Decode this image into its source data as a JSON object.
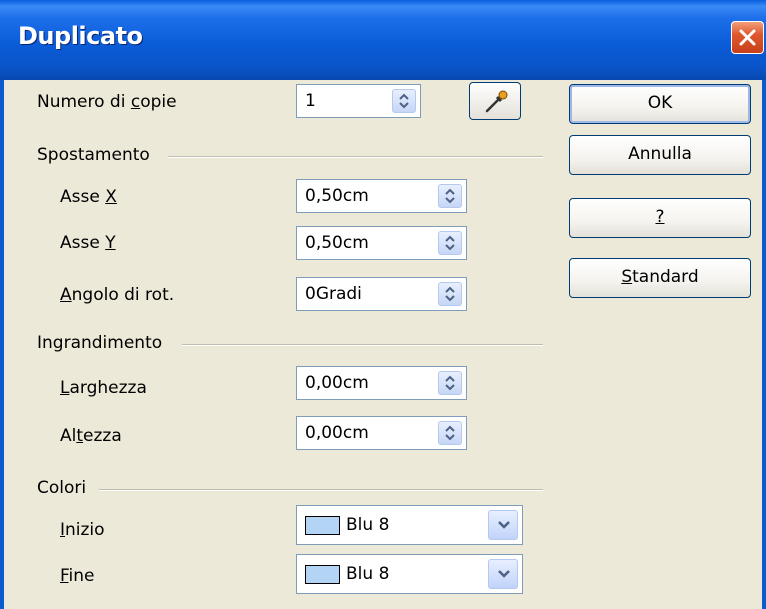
{
  "window": {
    "title": "Duplicato"
  },
  "copies": {
    "label_pre": "Numero di ",
    "label_accel": "c",
    "label_post": "opie",
    "value": "1"
  },
  "displacement": {
    "group": "Spostamento",
    "x_axis": {
      "label_pre": "Asse ",
      "label_accel": "X",
      "label_post": "",
      "value": "0,50cm"
    },
    "y_axis": {
      "label_pre": "Asse ",
      "label_accel": "Y",
      "label_post": "",
      "value": "0,50cm"
    },
    "angle": {
      "label_pre": "",
      "label_accel": "A",
      "label_post": "ngolo di rot.",
      "value": "0Gradi"
    }
  },
  "enlargement": {
    "group": "Ingrandimento",
    "width": {
      "label_pre": "",
      "label_accel": "L",
      "label_post": "arghezza",
      "value": "0,00cm"
    },
    "height": {
      "label_pre": "Al",
      "label_accel": "t",
      "label_post": "ezza",
      "value": "0,00cm"
    }
  },
  "colors": {
    "group": "Colori",
    "start": {
      "label_pre": "",
      "label_accel": "I",
      "label_post": "nizio",
      "value": "Blu 8",
      "swatch": "#B3D4F5"
    },
    "end": {
      "label_pre": "",
      "label_accel": "F",
      "label_post": "ine",
      "value": "Blu 8",
      "swatch": "#B3D4F5"
    }
  },
  "buttons": {
    "ok": "OK",
    "cancel": "Annulla",
    "help_accel": "?",
    "standard_accel": "S",
    "standard_post": "tandard"
  },
  "icons": {
    "close": "close-icon",
    "picker": "pipette-icon",
    "spin": "spin-arrows-icon",
    "dropdown": "chevron-down-icon"
  }
}
